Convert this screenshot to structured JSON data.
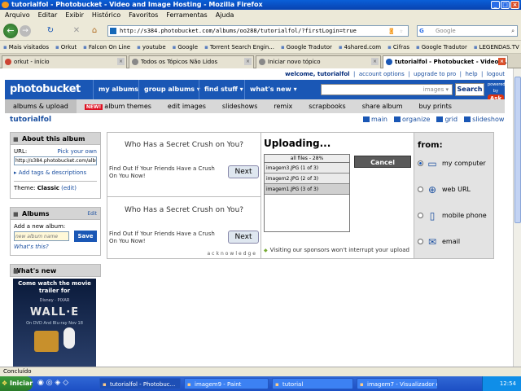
{
  "window": {
    "title": "tutorialfol - Photobucket - Video and Image Hosting - Mozilla Firefox"
  },
  "menu": [
    "Arquivo",
    "Editar",
    "Exibir",
    "Histórico",
    "Favoritos",
    "Ferramentas",
    "Ajuda"
  ],
  "nav": {
    "url": "http://s384.photobucket.com/albums/oo288/tutorialfol/?firstLogin=true",
    "search_placeholder": "Google"
  },
  "bookmarks": [
    "Mais visitados",
    "Orkut",
    "Falcon On Line",
    "youtube",
    "Google",
    "Torrent Search Engin...",
    "Google Tradutor",
    "4shared.com",
    "Cifras",
    "Google Tradutor",
    "LEGENDAS.TV"
  ],
  "tabs": [
    {
      "label": "orkut - início"
    },
    {
      "label": "Todos os Tópicos Não Lidos"
    },
    {
      "label": "Iniciar novo tópico"
    },
    {
      "label": "tutorialfol - Photobucket - Video ..."
    }
  ],
  "pb": {
    "welcome": "welcome, tutorialfol",
    "account_options": "account options",
    "upgrade": "upgrade to pro",
    "help": "help",
    "logout": "logout",
    "logo": "photobucket",
    "nav": [
      "my albums",
      "group albums ▾",
      "find stuff ▾",
      "what's new ▾"
    ],
    "search_option": "images ▾",
    "search_btn": "Search",
    "ask_small": "powered by",
    "ask": "Ask",
    "subnav": [
      "albums & upload",
      "album themes",
      "edit images",
      "slideshows",
      "remix",
      "scrapbooks",
      "share album",
      "buy prints"
    ],
    "new_badge": "NEW!",
    "album_name": "tutorialfol",
    "views": [
      "main",
      "organize",
      "grid",
      "slideshow"
    ]
  },
  "about": {
    "title": "About this album",
    "url_label": "URL:",
    "pick_own": "Pick your own",
    "url_value": "http://s384.photobucket.com/album",
    "add_tags": "Add tags & descriptions",
    "theme_label": "Theme:",
    "theme_value": "Classic",
    "theme_edit": "(edit)"
  },
  "albums": {
    "title": "Albums",
    "edit": "Edit",
    "add_label": "Add a new album:",
    "placeholder": "new album name",
    "save": "Save",
    "whats_this": "What's this?"
  },
  "whats_new": {
    "title": "What's new",
    "movie_line": "Come watch the movie trailer for",
    "studio": "Disney · PIXAR",
    "movie_title": "WALL·E",
    "dvd": "On DVD And Blu-ray Nov 18"
  },
  "ads": [
    {
      "question": "Who Has a Secret Crush on You?",
      "sub": "Find Out If Your Friends Have a Crush On You Now!",
      "btn": "Next"
    },
    {
      "question": "Who Has a Secret Crush on You?",
      "sub": "Find Out If Your Friends Have a Crush On You Now!",
      "btn": "Next"
    }
  ],
  "ack": "acknowledge",
  "upload": {
    "title": "Uploading...",
    "all_files": "all files - 28%",
    "progress": 28,
    "files": [
      "imagem3.JPG (1 of 3)",
      "imagem2.JPG (2 of 3)",
      "imagem1.JPG (3 of 3)"
    ],
    "cancel": "Cancel",
    "sponsor": "Visiting our sponsors won't interrupt your upload"
  },
  "from": {
    "title": "from:",
    "options": [
      {
        "label": "my computer",
        "icon": "monitor-icon",
        "selected": true
      },
      {
        "label": "web URL",
        "icon": "globe-icon",
        "selected": false
      },
      {
        "label": "mobile phone",
        "icon": "phone-icon",
        "selected": false
      },
      {
        "label": "email",
        "icon": "envelope-icon",
        "selected": false
      }
    ]
  },
  "status": "Concluído",
  "taskbar": {
    "start": "Iniciar",
    "tasks": [
      "tutorialfol - Photobuc...",
      "imagem9 - Paint",
      "tutorial",
      "imagem7 - Visualizador d..."
    ],
    "clock": "12:54"
  },
  "colors": {
    "pb_blue": "#1a57b5",
    "link": "#1a4fa0",
    "xp_blue": "#1c4fc4"
  }
}
